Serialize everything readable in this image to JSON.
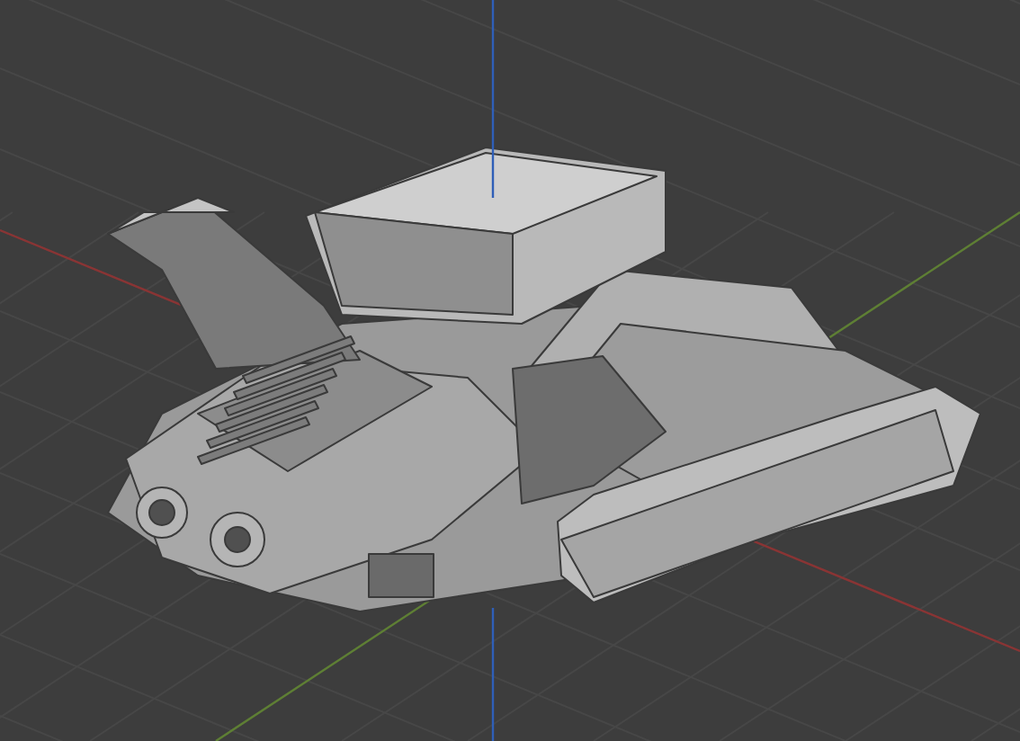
{
  "viewport": {
    "grid": true,
    "axes": [
      {
        "kind": "x",
        "color": "#8a3434"
      },
      {
        "kind": "y",
        "color": "#5e7f34"
      },
      {
        "kind": "z",
        "color": "#2f5fb8"
      }
    ]
  }
}
